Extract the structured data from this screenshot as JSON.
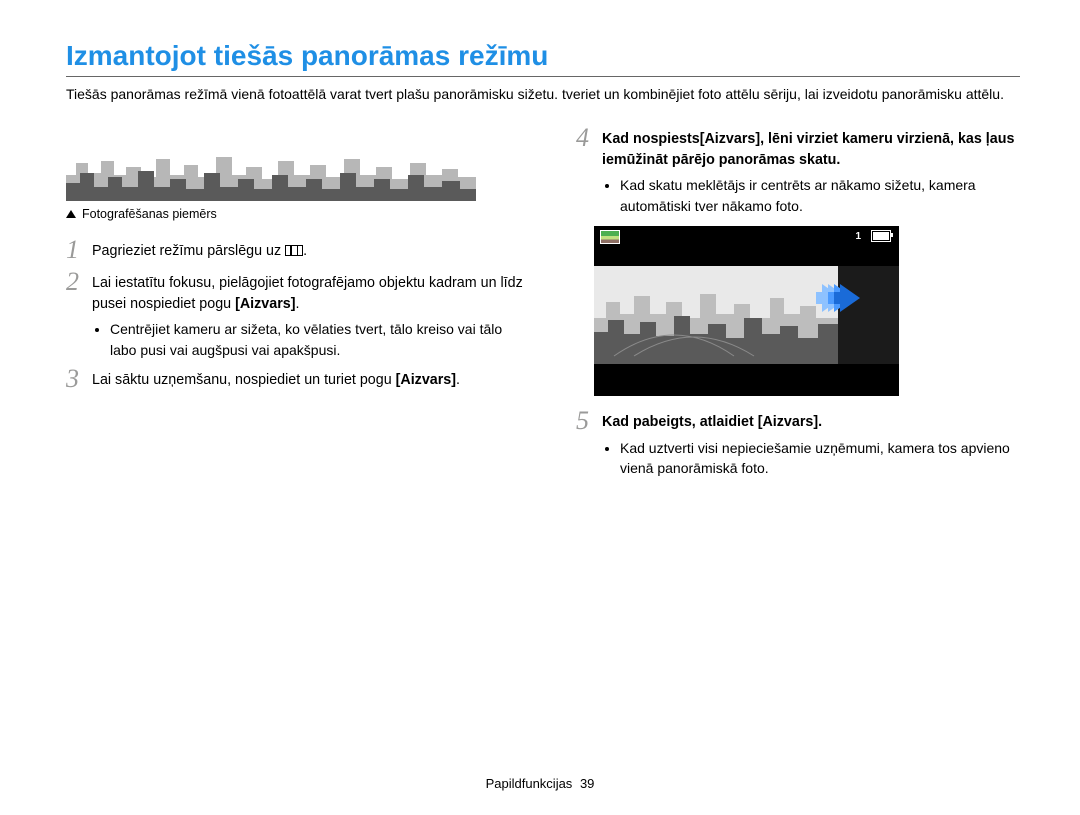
{
  "title": "Izmantojot tiešās panorāmas režīmu",
  "intro": "Tiešās panorāmas režīmā vienā fotoattēlā varat tvert plašu panorāmisku sižetu. tveriet un kombinējiet foto attēlu sēriju, lai izveidotu panorāmisku attēlu.",
  "caption": "Fotografēšanas piemērs",
  "steps": {
    "s1_pre": "Pagrieziet režīmu pārslēgu uz ",
    "s1_post": ".",
    "s2_a": "Lai iestatītu fokusu, pielāgojiet fotografējamo objektu kadram un līdz pusei nospiediet pogu ",
    "s2_b": "[Aizvars]",
    "s2_c": ".",
    "s2_sub": "Centrējiet kameru ar sižeta, ko vēlaties tvert, tālo kreiso vai tālo labo pusi vai augšpusi vai apakšpusi.",
    "s3_a": "Lai sāktu uzņemšanu, nospiediet un turiet pogu ",
    "s3_b": "[Aizvars]",
    "s3_c": ".",
    "s4_a": "Kad nospiests",
    "s4_b": "[Aizvars]",
    "s4_c": ", lēni virziet kameru virzienā, kas ļaus iemūžināt pārējo panorāmas skatu.",
    "s4_sub": "Kad skatu meklētājs ir centrēts ar nākamo sižetu, kamera automātiski tver nākamo foto.",
    "s5_a": "Kad pabeigts, atlaidiet ",
    "s5_b": "[Aizvars]",
    "s5_c": ".",
    "s5_sub": "Kad uztverti visi nepieciešamie uzņēmumi, kamera tos apvieno vienā panorāmiskā foto."
  },
  "cam": {
    "counter": "1"
  },
  "footer_section": "Papildfunkcijas",
  "footer_page": "39"
}
